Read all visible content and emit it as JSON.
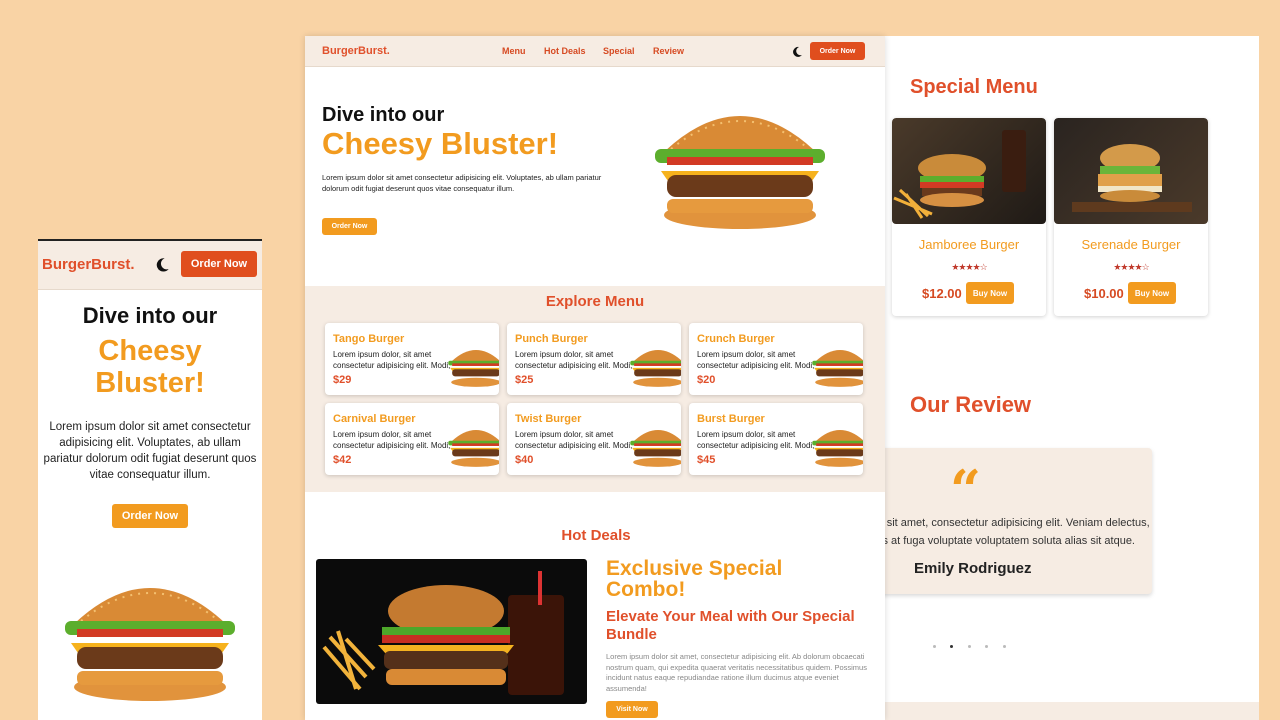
{
  "brand": "BurgerBurst.",
  "nav": {
    "menu": "Menu",
    "hot_deals": "Hot Deals",
    "special": "Special",
    "review": "Review",
    "order_btn": "Order Now"
  },
  "hero": {
    "line1": "Dive into our",
    "line2": "Cheesy Bluster!",
    "desc": "Lorem ipsum dolor sit amet consectetur adipisicing elit. Voluptates, ab ullam pariatur dolorum odit fugiat deserunt quos vitae consequatur illum.",
    "btn": "Order Now"
  },
  "mobile": {
    "line2a": "Cheesy",
    "line2b": "Bluster!"
  },
  "explore": {
    "title": "Explore Menu",
    "items": [
      {
        "name": "Tango Burger",
        "desc": "Lorem ipsum dolor, sit amet consectetur adipisicing elit. Modi, laborum!",
        "price": "$29"
      },
      {
        "name": "Punch Burger",
        "desc": "Lorem ipsum dolor, sit amet consectetur adipisicing elit. Modi, laborum!",
        "price": "$25"
      },
      {
        "name": "Crunch Burger",
        "desc": "Lorem ipsum dolor, sit amet consectetur adipisicing elit. Modi, laborum!",
        "price": "$20"
      },
      {
        "name": "Carnival Burger",
        "desc": "Lorem ipsum dolor, sit amet consectetur adipisicing elit. Modi, laborum!",
        "price": "$42"
      },
      {
        "name": "Twist Burger",
        "desc": "Lorem ipsum dolor, sit amet consectetur adipisicing elit. Modi, laborum!",
        "price": "$40"
      },
      {
        "name": "Burst Burger",
        "desc": "Lorem ipsum dolor, sit amet consectetur adipisicing elit. Modi, laborum!",
        "price": "$45"
      }
    ]
  },
  "hot": {
    "title": "Hot Deals",
    "h1": "Exclusive Special Combo!",
    "h2": "Elevate Your Meal with Our Special Bundle",
    "desc": "Lorem ipsum dolor sit amet, consectetur adipisicing elit. Ab dolorum obcaecati nostrum quam, qui expedita quaerat veritatis necessitatibus quidem. Possimus incidunt natus eaque repudiandae ratione illum ducimus atque eveniet assumenda!",
    "btn": "Visit Now"
  },
  "special": {
    "title": "Special Menu",
    "items": [
      {
        "name": "Jamboree Burger",
        "price": "$12.00",
        "btn": "Buy Now",
        "rating": 4.5
      },
      {
        "name": "Serenade Burger",
        "price": "$10.00",
        "btn": "Buy Now",
        "rating": 4.5
      }
    ]
  },
  "review": {
    "title": "Our Review",
    "quote": "“",
    "text1": "r sit amet, consectetur adipisicing elit. Veniam delectus,",
    "text2": "is at fuga voluptate voluptatem soluta alias sit atque.",
    "name": "Emily Rodriguez",
    "active_dot": 1
  },
  "colors": {
    "bg": "#f9d3a5",
    "orange": "#f29b1f",
    "red": "#e0502b",
    "nav_bg": "#f6ece3"
  }
}
